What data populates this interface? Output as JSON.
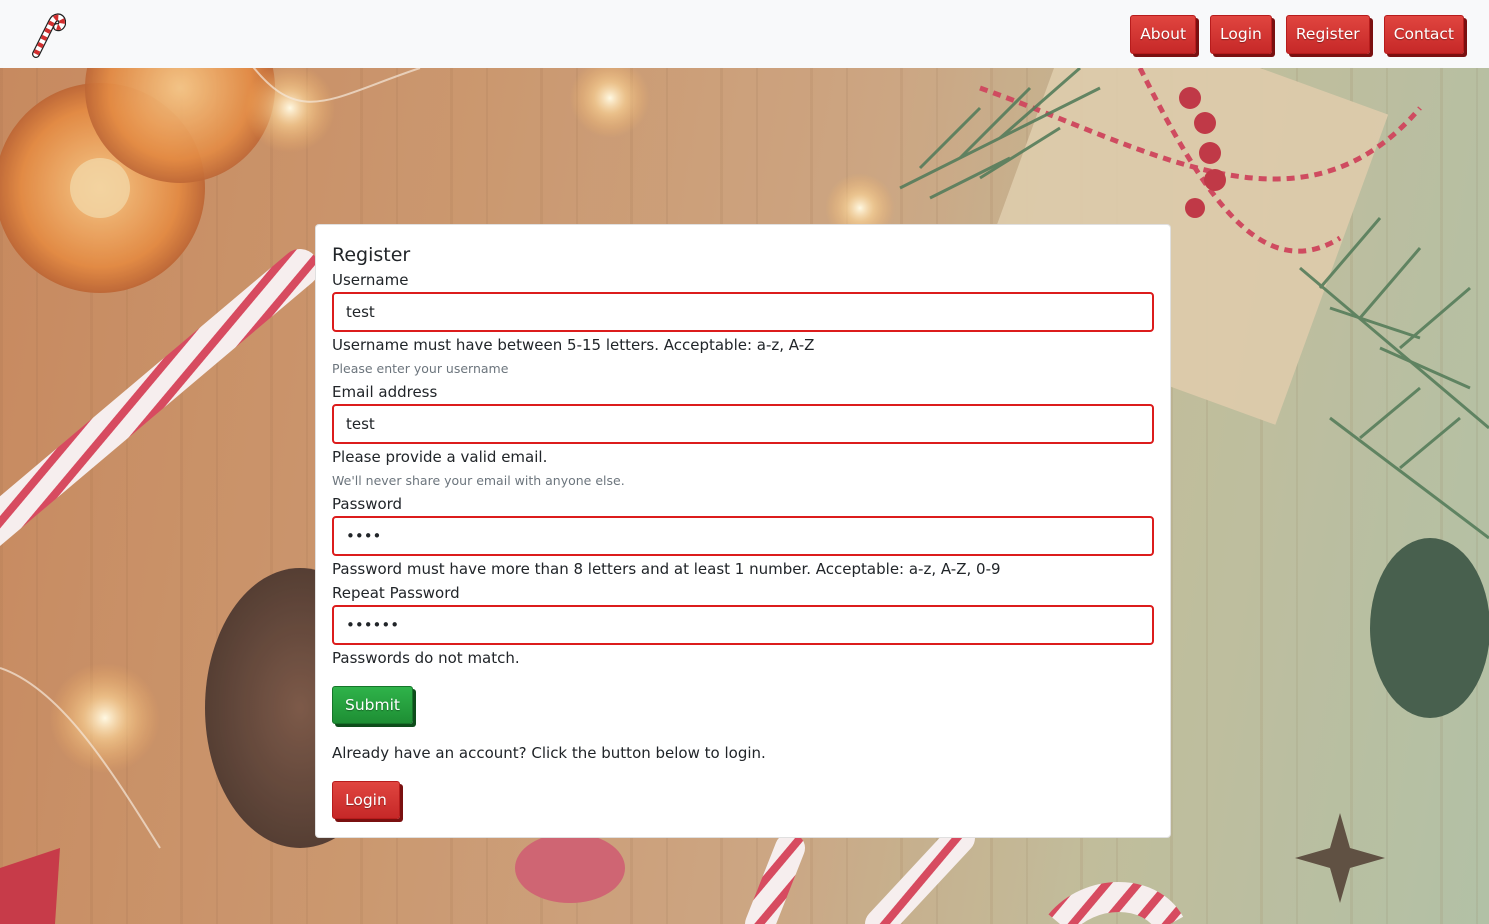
{
  "navbar": {
    "brand_icon": "candy-cane-icon",
    "links": [
      {
        "label": "About"
      },
      {
        "label": "Login"
      },
      {
        "label": "Register"
      },
      {
        "label": "Contact"
      }
    ]
  },
  "form": {
    "title": "Register",
    "username": {
      "label": "Username",
      "value": "test",
      "error": "Username must have between 5-15 letters. Acceptable: a-z, A-Z",
      "hint": "Please enter your username"
    },
    "email": {
      "label": "Email address",
      "value": "test",
      "error": "Please provide a valid email.",
      "hint": "We'll never share your email with anyone else."
    },
    "password": {
      "label": "Password",
      "value": "••••",
      "error": "Password must have more than 8 letters and at least 1 number. Acceptable: a-z, A-Z, 0-9"
    },
    "repeat_password": {
      "label": "Repeat Password",
      "value": "••••••",
      "error": "Passwords do not match."
    },
    "submit_label": "Submit",
    "already_text": "Already have an account? Click the button below to login.",
    "login_label": "Login"
  },
  "colors": {
    "nav_button": "#d32f2f",
    "submit_button": "#28a745",
    "invalid_border": "#dc1c1c",
    "navbar_bg": "#f8f9fa"
  }
}
